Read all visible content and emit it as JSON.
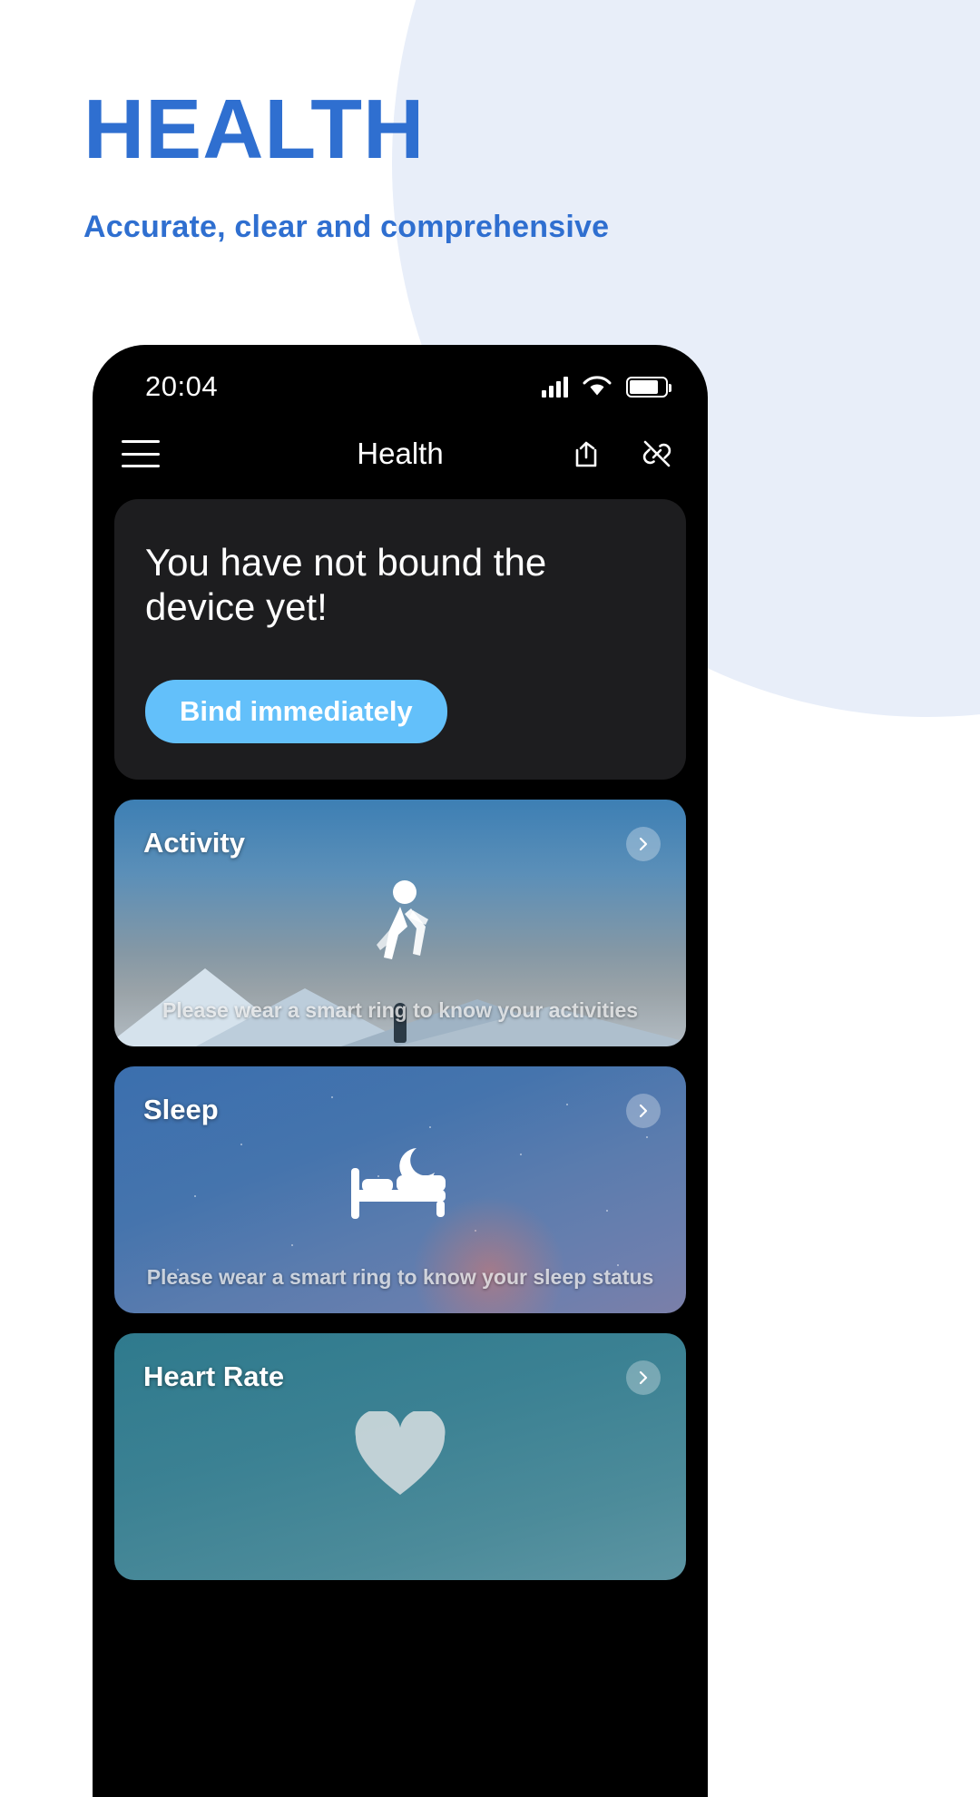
{
  "promo": {
    "headline": "HEALTH",
    "subheadline": "Accurate, clear and comprehensive",
    "accent_color": "#2f6fd0",
    "blob_color": "#e8eef9"
  },
  "phone": {
    "statusbar": {
      "time": "20:04",
      "signal_icon": "cellular-signal-icon",
      "wifi_icon": "wifi-icon",
      "battery_icon": "battery-icon",
      "battery_level": "82%"
    },
    "appbar": {
      "menu_icon": "hamburger-menu-icon",
      "title": "Health",
      "share_icon": "share-icon",
      "unbind_icon": "unlink-icon"
    },
    "bind_card": {
      "title": "You have not bound the device yet!",
      "button_label": "Bind immediately",
      "button_color": "#63c0fa",
      "card_color": "#1d1d1f"
    },
    "cards": [
      {
        "title": "Activity",
        "caption": "Please wear a smart ring to know your activities",
        "glyph": "walking-person-icon",
        "arrow_icon": "chevron-right-icon"
      },
      {
        "title": "Sleep",
        "caption": "Please wear a smart ring to know your sleep status",
        "glyph": "bed-moon-icon",
        "arrow_icon": "chevron-right-icon"
      },
      {
        "title": "Heart Rate",
        "caption": "",
        "glyph": "heart-icon",
        "arrow_icon": "chevron-right-icon"
      }
    ]
  }
}
